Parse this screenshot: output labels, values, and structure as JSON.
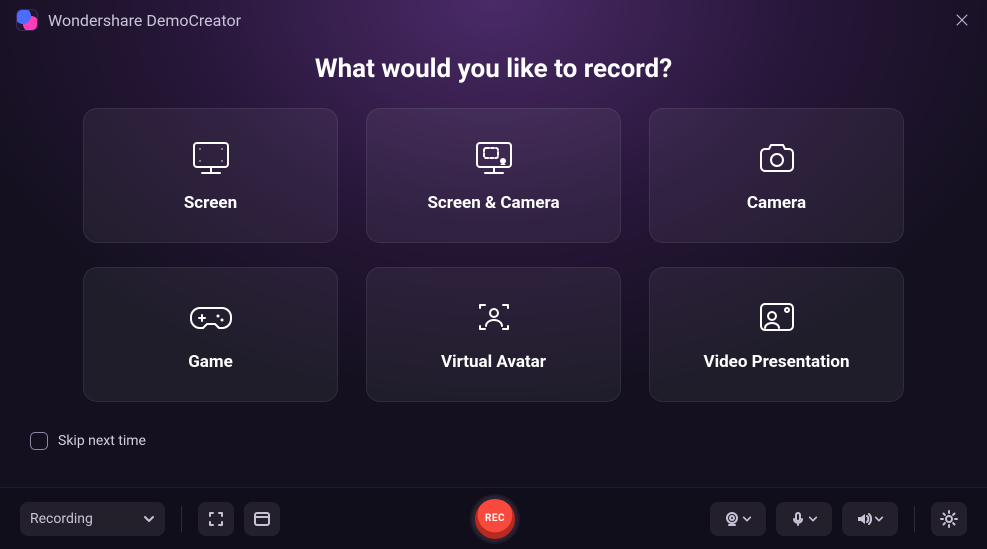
{
  "titlebar": {
    "brand": "Wondershare DemoCreator"
  },
  "main": {
    "heading": "What would you like to record?",
    "cards": [
      {
        "icon": "screen-icon",
        "label": "Screen"
      },
      {
        "icon": "screen-camera-icon",
        "label": "Screen & Camera"
      },
      {
        "icon": "camera-icon",
        "label": "Camera"
      },
      {
        "icon": "game-icon",
        "label": "Game"
      },
      {
        "icon": "virtual-avatar-icon",
        "label": "Virtual Avatar"
      },
      {
        "icon": "video-presentation-icon",
        "label": "Video Presentation"
      }
    ],
    "skip_label": "Skip next time"
  },
  "toolbar": {
    "mode_label": "Recording",
    "rec_label": "REC"
  }
}
